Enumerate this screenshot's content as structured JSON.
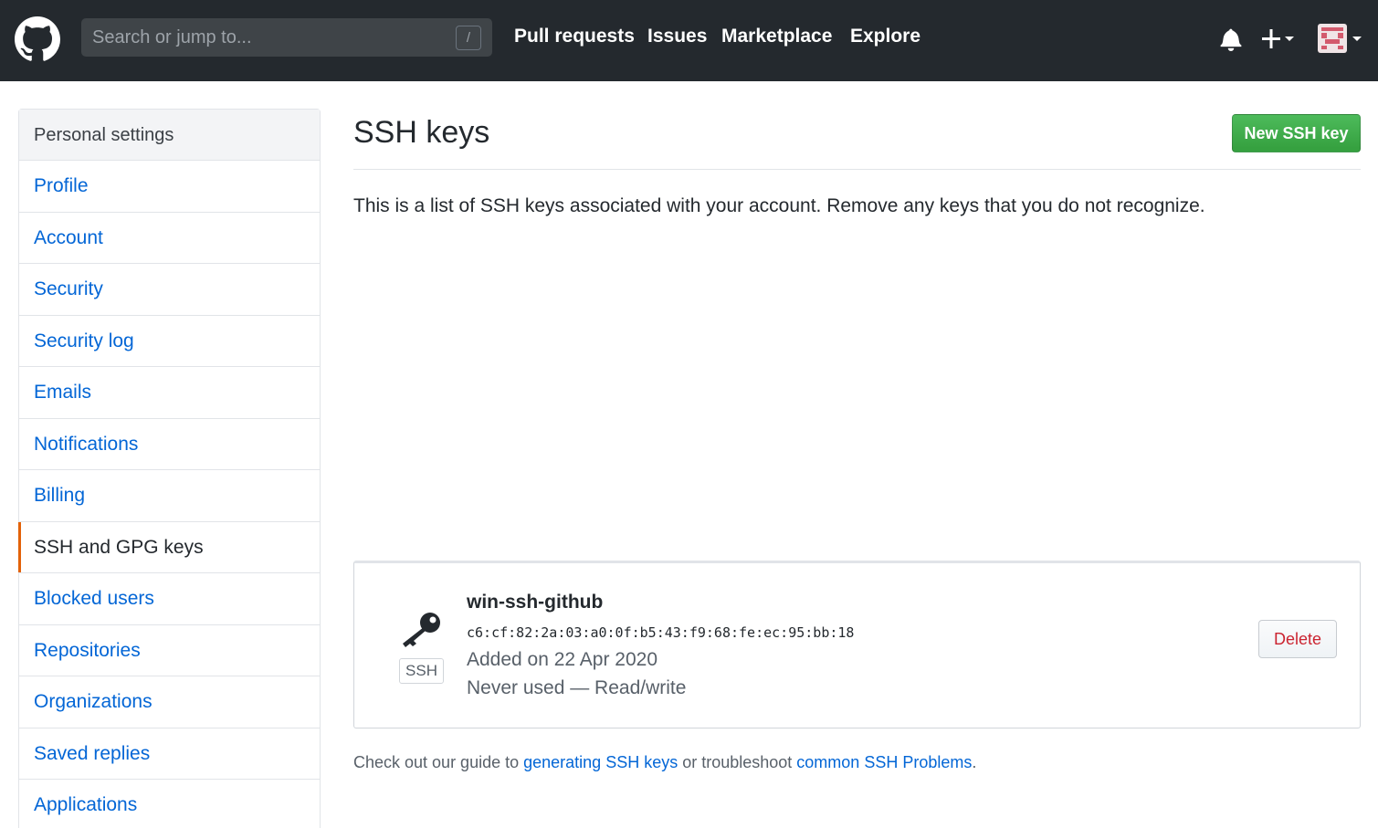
{
  "header": {
    "search_placeholder": "Search or jump to...",
    "search_shortcut": "/",
    "nav": [
      "Pull requests",
      "Issues",
      "Marketplace",
      "Explore"
    ]
  },
  "sidebar": {
    "heading": "Personal settings",
    "items": [
      {
        "label": "Profile"
      },
      {
        "label": "Account"
      },
      {
        "label": "Security"
      },
      {
        "label": "Security log"
      },
      {
        "label": "Emails"
      },
      {
        "label": "Notifications"
      },
      {
        "label": "Billing"
      },
      {
        "label": "SSH and GPG keys",
        "selected": true
      },
      {
        "label": "Blocked users"
      },
      {
        "label": "Repositories"
      },
      {
        "label": "Organizations"
      },
      {
        "label": "Saved replies"
      },
      {
        "label": "Applications"
      }
    ]
  },
  "main": {
    "title": "SSH keys",
    "new_key_button": "New SSH key",
    "intro": "This is a list of SSH keys associated with your account. Remove any keys that you do not recognize.",
    "key": {
      "type_label": "SSH",
      "title": "win-ssh-github",
      "fingerprint": "c6:cf:82:2a:03:a0:0f:b5:43:f9:68:fe:ec:95:bb:18",
      "added": "Added on 22 Apr 2020",
      "usage": "Never used — Read/write",
      "delete_button": "Delete"
    },
    "footer": {
      "prefix": "Check out our guide to ",
      "link1": "generating SSH keys",
      "middle": " or troubleshoot ",
      "link2": "common SSH Problems",
      "suffix": "."
    }
  },
  "colors": {
    "header_bg": "#24292e",
    "link": "#0366d6",
    "primary_button": "#28a745",
    "danger": "#cb2431",
    "selected_accent": "#e36209"
  },
  "icons": [
    "github-logo-icon",
    "bell-icon",
    "plus-icon",
    "avatar",
    "key-icon"
  ]
}
